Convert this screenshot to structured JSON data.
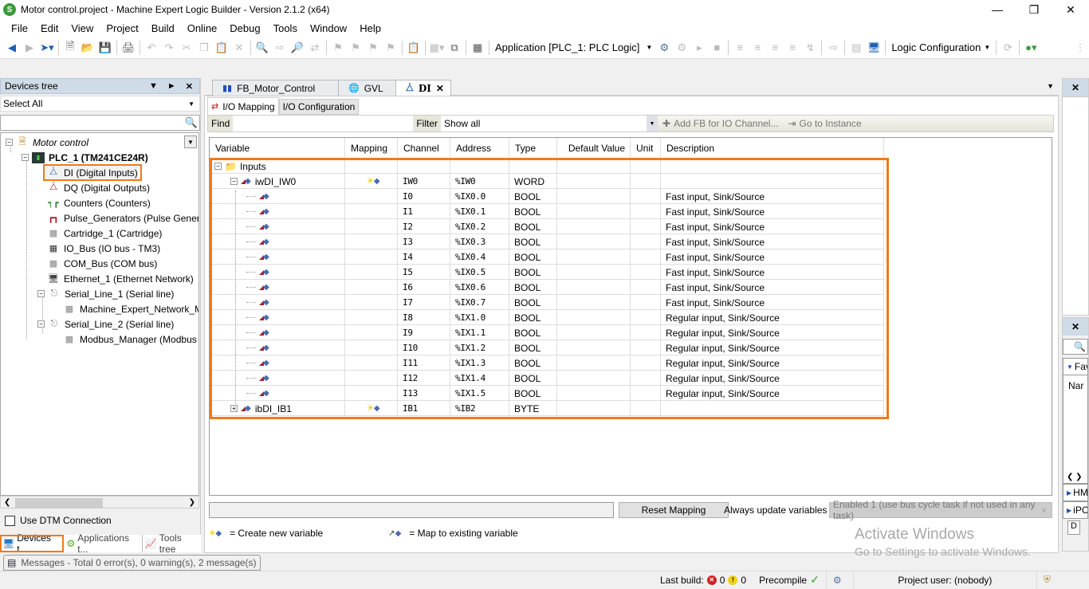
{
  "window": {
    "title": "Motor control.project - Machine Expert Logic Builder - Version 2.1.2 (x64)",
    "controls": [
      "minimize",
      "restore",
      "close"
    ]
  },
  "menu": [
    "File",
    "Edit",
    "View",
    "Project",
    "Build",
    "Online",
    "Debug",
    "Tools",
    "Window",
    "Help"
  ],
  "toolbar": {
    "application_combo": "Application [PLC_1: PLC Logic]",
    "config_combo": "Logic Configuration"
  },
  "devices_panel": {
    "title": "Devices tree",
    "filter_combo": "Select All",
    "search_placeholder": "",
    "tree": [
      {
        "label": "Motor control",
        "level": 0,
        "icon": "project-icon",
        "expanded": true,
        "italic": true
      },
      {
        "label": "PLC_1 (TM241CE24R)",
        "level": 1,
        "icon": "plc-icon",
        "expanded": true,
        "bold": true
      },
      {
        "label": "DI (Digital Inputs)",
        "level": 2,
        "icon": "digital-input-icon",
        "selected": true
      },
      {
        "label": "DQ (Digital Outputs)",
        "level": 2,
        "icon": "digital-output-icon"
      },
      {
        "label": "Counters (Counters)",
        "level": 2,
        "icon": "counter-icon"
      },
      {
        "label": "Pulse_Generators (Pulse Generators)",
        "level": 2,
        "icon": "pulse-generator-icon"
      },
      {
        "label": "Cartridge_1 (Cartridge)",
        "level": 2,
        "icon": "module-icon"
      },
      {
        "label": "IO_Bus (IO bus - TM3)",
        "level": 2,
        "icon": "io-bus-icon"
      },
      {
        "label": "COM_Bus (COM bus)",
        "level": 2,
        "icon": "module-icon"
      },
      {
        "label": "Ethernet_1 (Ethernet Network)",
        "level": 2,
        "icon": "ethernet-icon"
      },
      {
        "label": "Serial_Line_1 (Serial line)",
        "level": 2,
        "icon": "serial-line-icon",
        "expanded": true
      },
      {
        "label": "Machine_Expert_Network_Manager",
        "level": 3,
        "icon": "module-icon"
      },
      {
        "label": "Serial_Line_2 (Serial line)",
        "level": 2,
        "icon": "serial-line-icon",
        "expanded": true
      },
      {
        "label": "Modbus_Manager (Modbus Manager)",
        "level": 3,
        "icon": "module-icon"
      }
    ],
    "dtm_checkbox": {
      "label": "Use DTM Connection",
      "checked": false
    },
    "bottom_tabs": [
      "Devices t...",
      "Applications t...",
      "Tools tree"
    ]
  },
  "messages_tab": "Messages - Total 0 error(s), 0 warning(s), 2 message(s)",
  "editor": {
    "doc_tabs": [
      {
        "label": "FB_Motor_Control",
        "active": false
      },
      {
        "label": "GVL",
        "active": false
      },
      {
        "label": "DI",
        "active": true,
        "closable": true
      }
    ],
    "sub_tabs": [
      "I/O Mapping",
      "I/O Configuration"
    ],
    "find_label": "Find",
    "find_value": "",
    "filter_label": "Filter",
    "filter_value": "Show all",
    "add_fb_button": "Add FB for IO Channel...",
    "goto_button": "Go to Instance",
    "columns": [
      "Variable",
      "Mapping",
      "Channel",
      "Address",
      "Type",
      "Default Value",
      "Unit",
      "Description"
    ],
    "rows": [
      {
        "variable": "Inputs",
        "mapping": "",
        "channel": "",
        "address": "",
        "type": "",
        "default": "",
        "unit": "",
        "description": "",
        "kind": "folder"
      },
      {
        "variable": "iwDI_IW0",
        "mapping": "create",
        "channel": "IW0",
        "address": "%IW0",
        "type": "WORD",
        "default": "",
        "unit": "",
        "description": "",
        "kind": "word"
      },
      {
        "variable": "",
        "mapping": "",
        "channel": "I0",
        "address": "%IX0.0",
        "type": "BOOL",
        "default": "",
        "unit": "",
        "description": "Fast input, Sink/Source",
        "kind": "bit"
      },
      {
        "variable": "",
        "mapping": "",
        "channel": "I1",
        "address": "%IX0.1",
        "type": "BOOL",
        "default": "",
        "unit": "",
        "description": "Fast input, Sink/Source",
        "kind": "bit"
      },
      {
        "variable": "",
        "mapping": "",
        "channel": "I2",
        "address": "%IX0.2",
        "type": "BOOL",
        "default": "",
        "unit": "",
        "description": "Fast input, Sink/Source",
        "kind": "bit"
      },
      {
        "variable": "",
        "mapping": "",
        "channel": "I3",
        "address": "%IX0.3",
        "type": "BOOL",
        "default": "",
        "unit": "",
        "description": "Fast input, Sink/Source",
        "kind": "bit"
      },
      {
        "variable": "",
        "mapping": "",
        "channel": "I4",
        "address": "%IX0.4",
        "type": "BOOL",
        "default": "",
        "unit": "",
        "description": "Fast input, Sink/Source",
        "kind": "bit"
      },
      {
        "variable": "",
        "mapping": "",
        "channel": "I5",
        "address": "%IX0.5",
        "type": "BOOL",
        "default": "",
        "unit": "",
        "description": "Fast input, Sink/Source",
        "kind": "bit"
      },
      {
        "variable": "",
        "mapping": "",
        "channel": "I6",
        "address": "%IX0.6",
        "type": "BOOL",
        "default": "",
        "unit": "",
        "description": "Fast input, Sink/Source",
        "kind": "bit"
      },
      {
        "variable": "",
        "mapping": "",
        "channel": "I7",
        "address": "%IX0.7",
        "type": "BOOL",
        "default": "",
        "unit": "",
        "description": "Fast input, Sink/Source",
        "kind": "bit"
      },
      {
        "variable": "",
        "mapping": "",
        "channel": "I8",
        "address": "%IX1.0",
        "type": "BOOL",
        "default": "",
        "unit": "",
        "description": "Regular input, Sink/Source",
        "kind": "bit"
      },
      {
        "variable": "",
        "mapping": "",
        "channel": "I9",
        "address": "%IX1.1",
        "type": "BOOL",
        "default": "",
        "unit": "",
        "description": "Regular input, Sink/Source",
        "kind": "bit"
      },
      {
        "variable": "",
        "mapping": "",
        "channel": "I10",
        "address": "%IX1.2",
        "type": "BOOL",
        "default": "",
        "unit": "",
        "description": "Regular input, Sink/Source",
        "kind": "bit"
      },
      {
        "variable": "",
        "mapping": "",
        "channel": "I11",
        "address": "%IX1.3",
        "type": "BOOL",
        "default": "",
        "unit": "",
        "description": "Regular input, Sink/Source",
        "kind": "bit"
      },
      {
        "variable": "",
        "mapping": "",
        "channel": "I12",
        "address": "%IX1.4",
        "type": "BOOL",
        "default": "",
        "unit": "",
        "description": "Regular input, Sink/Source",
        "kind": "bit"
      },
      {
        "variable": "",
        "mapping": "",
        "channel": "I13",
        "address": "%IX1.5",
        "type": "BOOL",
        "default": "",
        "unit": "",
        "description": "Regular input, Sink/Source",
        "kind": "bit"
      },
      {
        "variable": "ibDI_IB1",
        "mapping": "create",
        "channel": "IB1",
        "address": "%IB2",
        "type": "BYTE",
        "default": "",
        "unit": "",
        "description": "",
        "kind": "byte"
      }
    ],
    "reset_mapping_button": "Reset Mapping",
    "always_update_label": "Always update variables",
    "always_update_value": "Enabled 1 (use bus cycle task if not used in any task)",
    "legend_create": "= Create new variable",
    "legend_map": "= Map to existing variable"
  },
  "right_panel": {
    "favorites_label": "Fav",
    "name_label": "Nar",
    "items": [
      "HM",
      "iPC"
    ],
    "bottom_tab": "D"
  },
  "watermark": {
    "line1": "Activate Windows",
    "line2": "Go to Settings to activate Windows."
  },
  "status": {
    "last_build_label": "Last build:",
    "errors": "0",
    "warnings": "0",
    "precompile_label": "Precompile",
    "project_user": "Project user: (nobody)"
  },
  "colors": {
    "highlight": "#f07a18",
    "panel_header": "#cfdbe6"
  }
}
